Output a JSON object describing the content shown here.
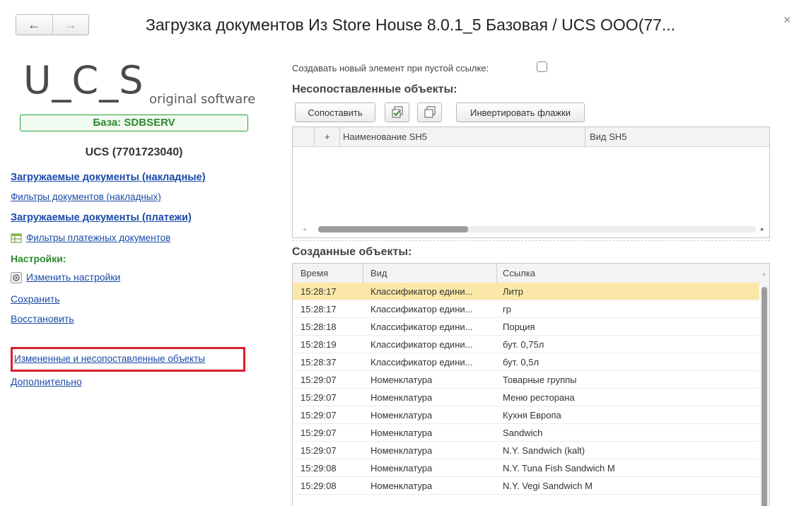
{
  "window": {
    "title": "Загрузка документов Из Store House 8.0.1_5 Базовая   / UCS ООО(77...",
    "back_icon": "←",
    "forward_icon": "→",
    "close_icon": "×"
  },
  "sidebar": {
    "logo_text": "U_C_S",
    "logo_subtitle": "original software",
    "database_label": "База: SDBSERV",
    "organization": "UCS (7701723040)",
    "links": {
      "loaded_invoices": "Загружаемые документы (накладные)",
      "invoice_filters": "Фильтры документов (накладных)",
      "loaded_payments": "Загружаемые документы (платежи)",
      "payment_filters": "Фильтры платежных документов"
    },
    "settings_header": "Настройки:",
    "settings_links": {
      "change_settings": "Изменить настройки",
      "save": "Сохранить",
      "restore": "Восстановить",
      "changed_unmatched": "Измененные и несопоставленные объекты",
      "additional": "Дополнительно"
    },
    "highlight_color": "#d8202c"
  },
  "main": {
    "create_on_empty_label": "Создавать новый элемент при пустой ссылке:",
    "create_on_empty_checked": false,
    "unmatched_title": "Несопоставленные объекты:",
    "toolbar": {
      "match_label": "Сопоставить",
      "invert_label": "Инвертировать флажки"
    },
    "unmatched_table": {
      "columns": [
        "+",
        "Наименование SH5",
        "Вид SH5"
      ],
      "rows": []
    },
    "created_title": "Созданные объекты:",
    "created_table": {
      "columns": [
        "Время",
        "Вид",
        "Ссылка"
      ],
      "selected_row": 0,
      "rows": [
        {
          "time": "15:28:17",
          "kind": "Классификатор едини...",
          "ref": "Литр"
        },
        {
          "time": "15:28:17",
          "kind": "Классификатор едини...",
          "ref": "гр"
        },
        {
          "time": "15:28:18",
          "kind": "Классификатор едини...",
          "ref": "Порция"
        },
        {
          "time": "15:28:19",
          "kind": "Классификатор едини...",
          "ref": "бут. 0,75л"
        },
        {
          "time": "15:28:37",
          "kind": "Классификатор едини...",
          "ref": "бут. 0,5л"
        },
        {
          "time": "15:29:07",
          "kind": "Номенклатура",
          "ref": "Товарные группы"
        },
        {
          "time": "15:29:07",
          "kind": "Номенклатура",
          "ref": "Меню ресторана"
        },
        {
          "time": "15:29:07",
          "kind": "Номенклатура",
          "ref": "Кухня Европа"
        },
        {
          "time": "15:29:07",
          "kind": "Номенклатура",
          "ref": "Sandwich"
        },
        {
          "time": "15:29:07",
          "kind": "Номенклатура",
          "ref": "N.Y. Sandwich (kalt)"
        },
        {
          "time": "15:29:08",
          "kind": "Номенклатура",
          "ref": "N.Y. Tuna Fish Sandwich M"
        },
        {
          "time": "15:29:08",
          "kind": "Номенклатура",
          "ref": "N.Y. Vegi Sandwich M"
        }
      ]
    },
    "selection_color": "#fbe8a8"
  }
}
